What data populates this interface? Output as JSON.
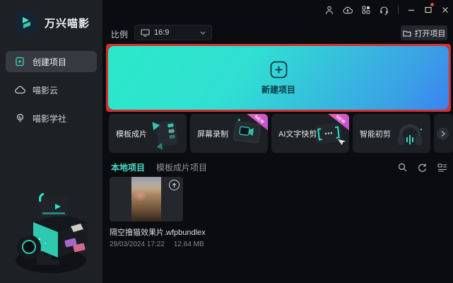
{
  "colors": {
    "accent_teal": "#2ee6c8",
    "banner_gradient_start": "#2be9c8",
    "banner_gradient_end": "#3b82f0",
    "banner_highlight_border": "#d43030",
    "badge_pink": "#e062b0",
    "sidebar_bg": "#1d2126",
    "main_bg": "#0a0c0f"
  },
  "window": {
    "title": "万兴喵影",
    "titlebar_icons": [
      "user-icon",
      "cloud-upload-icon",
      "grid-icon",
      "headset-icon",
      "minimize-icon",
      "maximize-icon",
      "close-icon"
    ]
  },
  "sidebar": {
    "items": [
      {
        "label": "创建项目",
        "icon": "file-plus-icon",
        "active": true
      },
      {
        "label": "喵影云",
        "icon": "cloud-icon",
        "active": false
      },
      {
        "label": "喵影学社",
        "icon": "bulb-icon",
        "active": false
      }
    ]
  },
  "toolbar": {
    "ratio_label": "比例",
    "ratio_value": "16:9",
    "open_project_label": "打开项目"
  },
  "banner": {
    "new_project_label": "新建项目"
  },
  "quick_actions": {
    "cards": [
      {
        "label": "模板成片",
        "badge": "",
        "icon": "clapperboard-art"
      },
      {
        "label": "屏幕录制",
        "badge": "NEW",
        "icon": "screen-record-art"
      },
      {
        "label": "AI文字快剪",
        "badge": "NEW",
        "icon": "text-brackets-art"
      },
      {
        "label": "智能初剪",
        "badge": "",
        "icon": "headphones-art"
      }
    ]
  },
  "projects": {
    "tab_local": "本地项目",
    "tab_template": "模板成片项目",
    "tool_icons": [
      "search-icon",
      "refresh-icon",
      "sort-icon"
    ],
    "items": [
      {
        "name": "隔空撸猫效果片.wfpbundlex",
        "date": "29/03/2024 17:22",
        "size": "12.64 MB"
      }
    ]
  }
}
